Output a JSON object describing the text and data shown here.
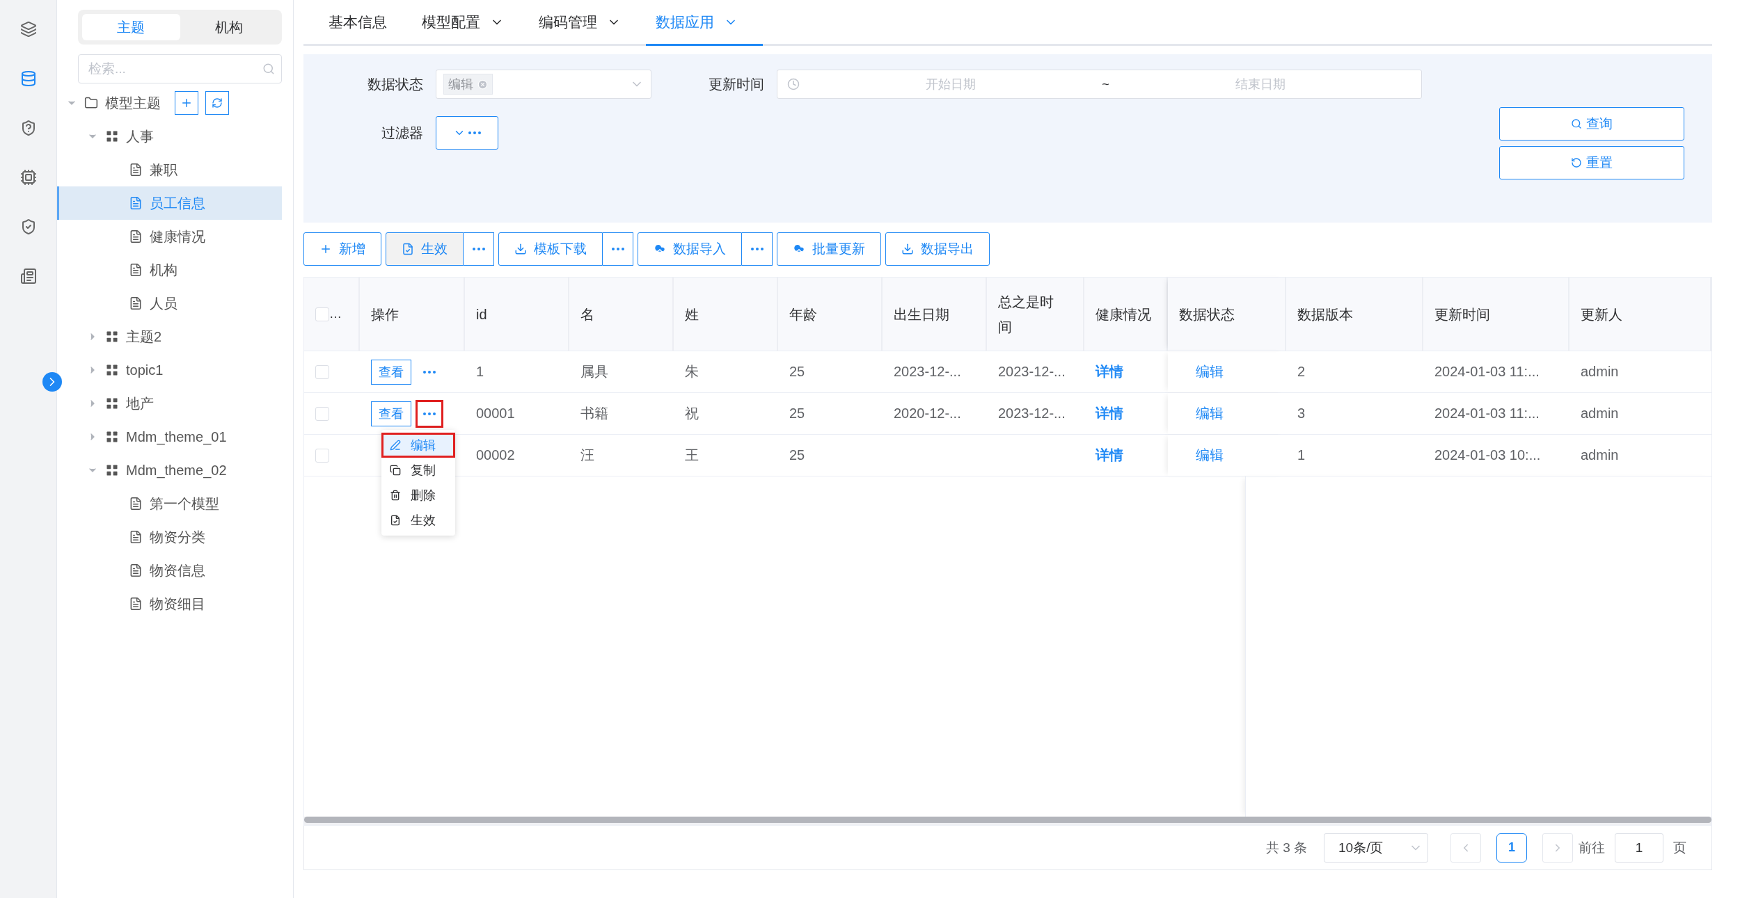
{
  "rail": {
    "items": [
      {
        "selected": false
      },
      {
        "selected": true
      },
      {
        "selected": false
      },
      {
        "selected": false
      },
      {
        "selected": false
      },
      {
        "selected": false
      }
    ]
  },
  "tree_panel": {
    "tabs": [
      {
        "label": "主题",
        "selected": true
      },
      {
        "label": "机构",
        "selected": false
      }
    ],
    "search": {
      "placeholder": "检索..."
    },
    "tree": [
      {
        "label": "模型主题",
        "kind": "folder",
        "expanded": true,
        "selected": false,
        "children": [
          {
            "label": "人事",
            "kind": "group",
            "expanded": true,
            "selected": false,
            "children": [
              {
                "label": "兼职",
                "kind": "model",
                "selected": false
              },
              {
                "label": "员工信息",
                "kind": "model",
                "selected": true
              },
              {
                "label": "健康情况",
                "kind": "model",
                "selected": false
              },
              {
                "label": "机构",
                "kind": "model",
                "selected": false
              },
              {
                "label": "人员",
                "kind": "model",
                "selected": false
              }
            ]
          },
          {
            "label": "主题2",
            "kind": "group",
            "expanded": false,
            "selected": false
          },
          {
            "label": "topic1",
            "kind": "group",
            "expanded": false,
            "selected": false
          },
          {
            "label": "地产",
            "kind": "group",
            "expanded": false,
            "selected": false
          },
          {
            "label": "Mdm_theme_01",
            "kind": "group",
            "expanded": false,
            "selected": false
          },
          {
            "label": "Mdm_theme_02",
            "kind": "group",
            "expanded": true,
            "selected": false,
            "children": [
              {
                "label": "第一个模型",
                "kind": "model",
                "selected": false
              },
              {
                "label": "物资分类",
                "kind": "model",
                "selected": false
              },
              {
                "label": "物资信息",
                "kind": "model",
                "selected": false
              },
              {
                "label": "物资细目",
                "kind": "model",
                "selected": false
              }
            ]
          }
        ]
      }
    ]
  },
  "top_tabs": [
    {
      "label": "基本信息",
      "selected": false,
      "dropdown": false
    },
    {
      "label": "模型配置",
      "selected": false,
      "dropdown": true
    },
    {
      "label": "编码管理",
      "selected": false,
      "dropdown": true
    },
    {
      "label": "数据应用",
      "selected": true,
      "dropdown": true
    }
  ],
  "filters": {
    "data_status": {
      "label": "数据状态",
      "tags": [
        "编辑"
      ]
    },
    "update_time": {
      "label": "更新时间",
      "start_placeholder": "开始日期",
      "separator": "~",
      "end_placeholder": "结束日期"
    },
    "filter": {
      "label": "过滤器"
    },
    "buttons": [
      {
        "label": "查询"
      },
      {
        "label": "重置"
      }
    ]
  },
  "toolbar": [
    {
      "label": "新增",
      "pressed": false,
      "more": false
    },
    {
      "label": "生效",
      "pressed": true,
      "more": true
    },
    {
      "label": "模板下载",
      "pressed": false,
      "more": true
    },
    {
      "label": "数据导入",
      "pressed": false,
      "more": true
    },
    {
      "label": "批量更新",
      "pressed": false,
      "more": false
    },
    {
      "label": "数据导出",
      "pressed": false,
      "more": false
    }
  ],
  "table": {
    "select_all": {
      "checked": false,
      "label": "…"
    },
    "columns": [
      {
        "label": "操作",
        "kind": "action"
      },
      {
        "label": "id",
        "kind": "text"
      },
      {
        "label": "名",
        "kind": "text"
      },
      {
        "label": "姓",
        "kind": "text"
      },
      {
        "label": "年龄",
        "kind": "text"
      },
      {
        "label": "出生日期",
        "kind": "text"
      },
      {
        "label": "总之是时间",
        "kind": "text"
      },
      {
        "label": "健康情况",
        "kind": "strong-link"
      },
      {
        "label": "数据状态",
        "kind": "link"
      },
      {
        "label": "数据版本",
        "kind": "text"
      },
      {
        "label": "更新时间",
        "kind": "text"
      },
      {
        "label": "更新人",
        "kind": "text"
      }
    ],
    "rows": [
      {
        "checked": false,
        "menu_open": false,
        "cells": [
          "查看",
          "1",
          "属具",
          "朱",
          "25",
          "2023-12-...",
          "2023-12-...",
          "详情",
          "编辑",
          "2",
          "2024-01-03 11:...",
          "admin"
        ]
      },
      {
        "checked": false,
        "menu_open": true,
        "cells": [
          "查看",
          "00001",
          "书籍",
          "祝",
          "25",
          "2020-12-...",
          "2023-12-...",
          "详情",
          "编辑",
          "3",
          "2024-01-03 11:...",
          "admin"
        ]
      },
      {
        "checked": false,
        "menu_open": false,
        "cells": [
          null,
          "00002",
          "汪",
          "王",
          "25",
          null,
          null,
          "详情",
          "编辑",
          "1",
          "2024-01-03 10:...",
          "admin"
        ]
      }
    ],
    "row_menu": [
      {
        "label": "编辑",
        "highlighted": true
      },
      {
        "label": "复制",
        "highlighted": false
      },
      {
        "label": "删除",
        "highlighted": false
      },
      {
        "label": "生效",
        "highlighted": false
      }
    ]
  },
  "pagination": {
    "total": "共 3 条",
    "page_size": "10条/页",
    "pages": [
      {
        "label": "1",
        "selected": true
      }
    ],
    "goto_label": "前往",
    "goto_value": "1",
    "goto_unit": "页"
  }
}
